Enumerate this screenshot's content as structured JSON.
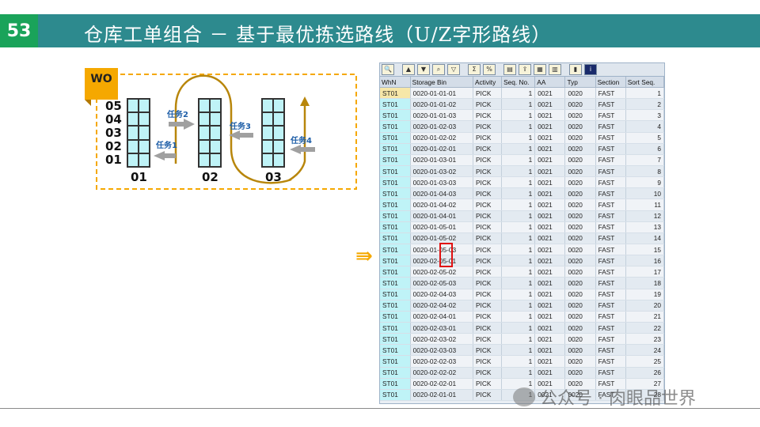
{
  "header": {
    "slide_number": "53",
    "title": "仓库工单组合 － 基于最优拣选路线（U/Z字形路线）"
  },
  "diagram": {
    "wo_label": "WO",
    "levels": [
      "05",
      "04",
      "03",
      "02",
      "01"
    ],
    "racks": [
      "01",
      "02",
      "03"
    ],
    "tasks": [
      "任务1",
      "任务2",
      "任务3",
      "任务4"
    ]
  },
  "table": {
    "columns": [
      "WhN",
      "Storage Bin",
      "Activity",
      "Seq. No.",
      "AA",
      "Typ",
      "Section",
      "Sort Seq."
    ],
    "rows": [
      [
        "ST01",
        "0020-01-01-01",
        "PICK",
        "1",
        "0021",
        "0020",
        "FAST",
        "1"
      ],
      [
        "ST01",
        "0020-01-01-02",
        "PICK",
        "1",
        "0021",
        "0020",
        "FAST",
        "2"
      ],
      [
        "ST01",
        "0020-01-01-03",
        "PICK",
        "1",
        "0021",
        "0020",
        "FAST",
        "3"
      ],
      [
        "ST01",
        "0020-01-02-03",
        "PICK",
        "1",
        "0021",
        "0020",
        "FAST",
        "4"
      ],
      [
        "ST01",
        "0020-01-02-02",
        "PICK",
        "1",
        "0021",
        "0020",
        "FAST",
        "5"
      ],
      [
        "ST01",
        "0020-01-02-01",
        "PICK",
        "1",
        "0021",
        "0020",
        "FAST",
        "6"
      ],
      [
        "ST01",
        "0020-01-03-01",
        "PICK",
        "1",
        "0021",
        "0020",
        "FAST",
        "7"
      ],
      [
        "ST01",
        "0020-01-03-02",
        "PICK",
        "1",
        "0021",
        "0020",
        "FAST",
        "8"
      ],
      [
        "ST01",
        "0020-01-03-03",
        "PICK",
        "1",
        "0021",
        "0020",
        "FAST",
        "9"
      ],
      [
        "ST01",
        "0020-01-04-03",
        "PICK",
        "1",
        "0021",
        "0020",
        "FAST",
        "10"
      ],
      [
        "ST01",
        "0020-01-04-02",
        "PICK",
        "1",
        "0021",
        "0020",
        "FAST",
        "11"
      ],
      [
        "ST01",
        "0020-01-04-01",
        "PICK",
        "1",
        "0021",
        "0020",
        "FAST",
        "12"
      ],
      [
        "ST01",
        "0020-01-05-01",
        "PICK",
        "1",
        "0021",
        "0020",
        "FAST",
        "13"
      ],
      [
        "ST01",
        "0020-01-05-02",
        "PICK",
        "1",
        "0021",
        "0020",
        "FAST",
        "14"
      ],
      [
        "ST01",
        "0020-01-05-03",
        "PICK",
        "1",
        "0021",
        "0020",
        "FAST",
        "15"
      ],
      [
        "ST01",
        "0020-02-05-01",
        "PICK",
        "1",
        "0021",
        "0020",
        "FAST",
        "16"
      ],
      [
        "ST01",
        "0020-02-05-02",
        "PICK",
        "1",
        "0021",
        "0020",
        "FAST",
        "17"
      ],
      [
        "ST01",
        "0020-02-05-03",
        "PICK",
        "1",
        "0021",
        "0020",
        "FAST",
        "18"
      ],
      [
        "ST01",
        "0020-02-04-03",
        "PICK",
        "1",
        "0021",
        "0020",
        "FAST",
        "19"
      ],
      [
        "ST01",
        "0020-02-04-02",
        "PICK",
        "1",
        "0021",
        "0020",
        "FAST",
        "20"
      ],
      [
        "ST01",
        "0020-02-04-01",
        "PICK",
        "1",
        "0021",
        "0020",
        "FAST",
        "21"
      ],
      [
        "ST01",
        "0020-02-03-01",
        "PICK",
        "1",
        "0021",
        "0020",
        "FAST",
        "22"
      ],
      [
        "ST01",
        "0020-02-03-02",
        "PICK",
        "1",
        "0021",
        "0020",
        "FAST",
        "23"
      ],
      [
        "ST01",
        "0020-02-03-03",
        "PICK",
        "1",
        "0021",
        "0020",
        "FAST",
        "24"
      ],
      [
        "ST01",
        "0020-02-02-03",
        "PICK",
        "1",
        "0021",
        "0020",
        "FAST",
        "25"
      ],
      [
        "ST01",
        "0020-02-02-02",
        "PICK",
        "1",
        "0021",
        "0020",
        "FAST",
        "26"
      ],
      [
        "ST01",
        "0020-02-02-01",
        "PICK",
        "1",
        "0021",
        "0020",
        "FAST",
        "27"
      ],
      [
        "ST01",
        "0020-02-01-01",
        "PICK",
        "1",
        "0021",
        "0020",
        "FAST",
        "28"
      ]
    ]
  },
  "watermark": "公众号 · 肉眼品世界",
  "colors": {
    "title_bar": "#2d8a8e",
    "slide_num_bg": "#1aa35a",
    "accent_orange": "#f5a800",
    "route_line": "#b8860b",
    "rack_fill": "#bff3f7"
  }
}
